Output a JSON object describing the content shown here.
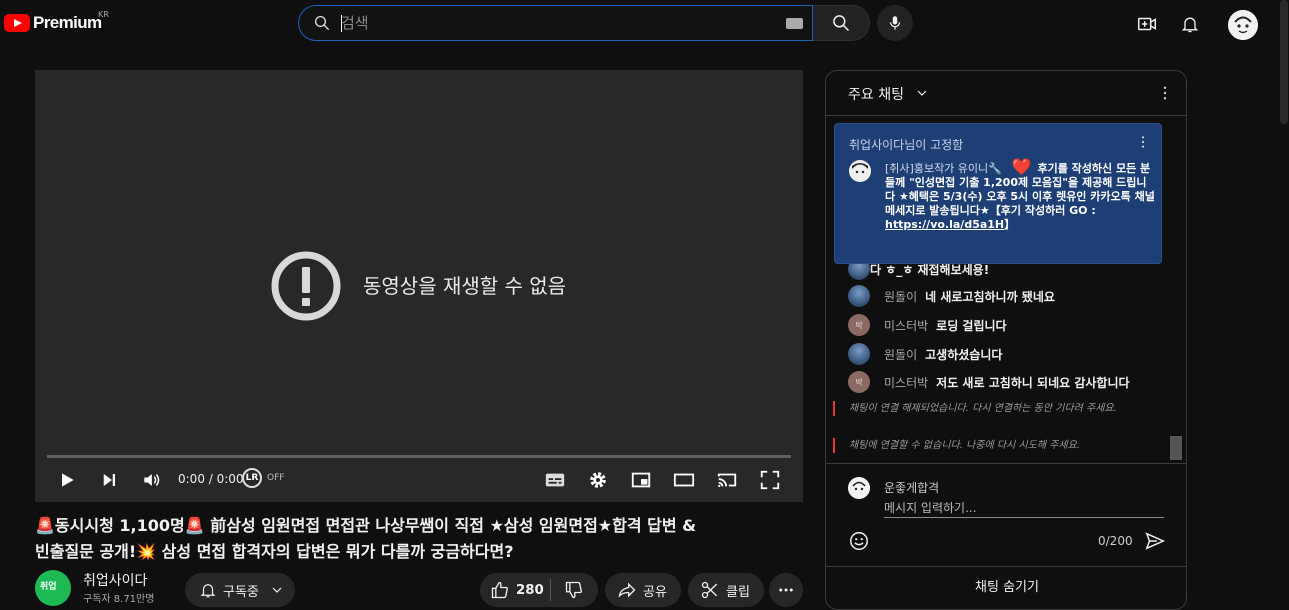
{
  "header": {
    "brand": "Premium",
    "region": "KR",
    "search_placeholder": "검색"
  },
  "player": {
    "error_message": "동영상을 재생할 수 없음",
    "time": "0:00 / 0:00",
    "lr_logo": "LR",
    "lr_state": "OFF"
  },
  "video": {
    "title_line1": "🚨동시시청 1,100명🚨 前삼성 임원면접 면접관 나상무쌤이 직접 ★삼성 임원면접★합격 답변 &",
    "title_line2": "빈출질문 공개!💥 삼성 면접 합격자의 답변은 뭐가 다를까 궁금하다면?"
  },
  "channel": {
    "avatar_text": "취업",
    "name": "취업사이다",
    "subscribers": "구독자 8.71만명",
    "subscribe_label": "구독중",
    "like_count": "280",
    "share_label": "공유",
    "clip_label": "클립"
  },
  "chat": {
    "mode_label": "주요 채팅",
    "pinned": {
      "title": "취업사이다님이 고정함",
      "author": "[취사]홍보작가 유이니🔧",
      "heart": "❤️",
      "message": "후기를 작성하신 모든 분들께 \"인성면접 기출 1,200제 모음집\"을 제공해 드립니다 ★혜택은 5/3(수) 오후 5시 이후 렛유인 카카오톡 채널 메세지로 발송됩니다★【후기 작성하러 GO : ",
      "link": "https://vo.la/d5a1H",
      "message_end": "】"
    },
    "partial_message": "다 ㅎ_ㅎ 재접해보세용!",
    "messages": [
      {
        "author": "원돌이",
        "text": "네 새로고침하니까 됐네요",
        "avatar": "wd"
      },
      {
        "author": "미스터박",
        "text": "로딩 걸립니다",
        "avatar": "park",
        "avatar_text": "박"
      },
      {
        "author": "원돌이",
        "text": "고생하셨습니다",
        "avatar": "wd"
      },
      {
        "author": "미스터박",
        "text": "저도 새로 고침하니 되네요 감사합니다",
        "avatar": "park",
        "avatar_text": "박"
      }
    ],
    "system_messages": [
      "채팅이 연결 해제되었습니다. 다시 연결하는 동안 기다려 주세요.",
      "채팅에 연결할 수 없습니다. 나중에 다시 시도해 주세요."
    ],
    "input": {
      "user_name": "운좋게합격",
      "placeholder": "메시지 입력하기...",
      "counter": "0/200"
    },
    "hide_label": "채팅 숨기기"
  },
  "colors": {
    "accent_red": "#ff0000",
    "search_border": "#1c62b9",
    "pinned_bg": "#1e3f75",
    "system_error": "#e53935"
  }
}
